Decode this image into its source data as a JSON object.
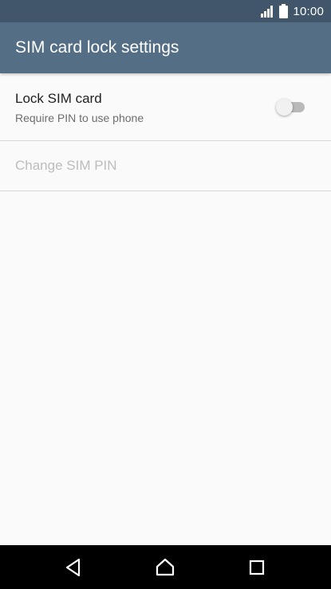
{
  "status_bar": {
    "time": "10:00",
    "icons": [
      "signal-icon",
      "battery-icon"
    ]
  },
  "app_bar": {
    "title": "SIM card lock settings"
  },
  "preferences": {
    "lock_sim": {
      "label": "Lock SIM card",
      "summary": "Require PIN to use phone",
      "enabled": false
    },
    "change_pin": {
      "label": "Change SIM PIN",
      "disabled": true
    }
  },
  "nav_bar": {
    "icons": [
      "back-icon",
      "home-icon",
      "recents-icon"
    ]
  },
  "colors": {
    "status_bar": "#41566a",
    "app_bar": "#546e85",
    "background": "#fafafa",
    "disabled_text": "#bdbdbd"
  }
}
